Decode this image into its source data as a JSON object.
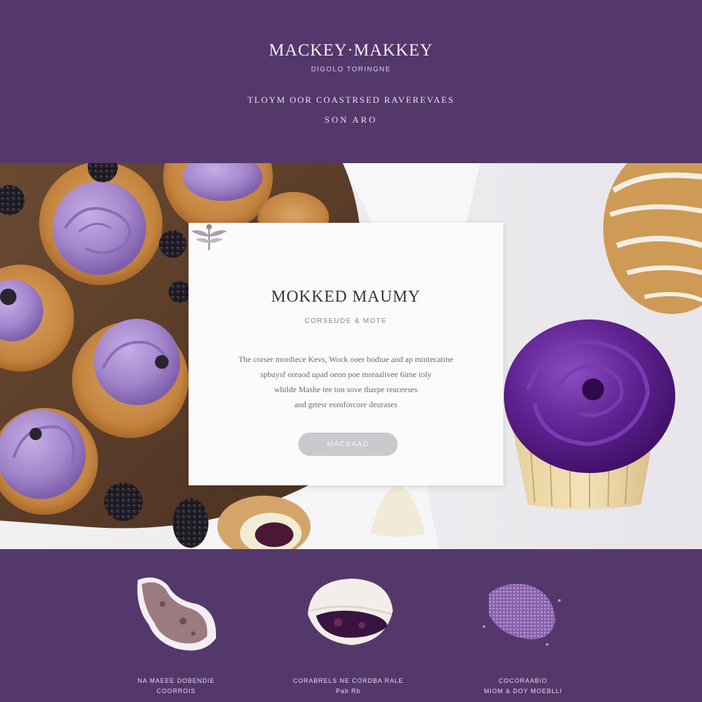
{
  "header": {
    "brand": "MACKEY·MAKKEY",
    "brand_sub": "DIGOLO TORINGNE",
    "tagline": "TLOYM OOR COASTRSED RAVEREVAES",
    "cta": "SON ARO"
  },
  "card": {
    "title": "MOKKED MAUMY",
    "subtitle": "CORSEUDE & MOTE",
    "body_lines": [
      "The corser mordiece Kevs, Wock ooer bodiue and ap mintecatine",
      "spbaysf oreaod upad oeon poe mreaalivee 6ime toly",
      "whilde Mashe tee ton sove tharpe reaceeses",
      "and grtesr eomforcore deurases"
    ],
    "button": "MACSAAD"
  },
  "features": [
    {
      "label": "NA MAEEE DOBENDIE",
      "sub": "COORROIS"
    },
    {
      "label": "CORABRELS NE CORDBA RALE",
      "sub": "Pab Rb"
    },
    {
      "label": "COCORAABIO",
      "sub": "MIOM & DOY MOEBLLI"
    }
  ],
  "colors": {
    "brand_purple": "#55386b",
    "frosting_lilac": "#a98bd0",
    "frosting_deep": "#5a1e87",
    "card_white": "#fbfbfc",
    "button_gray": "#c9c8cc"
  }
}
